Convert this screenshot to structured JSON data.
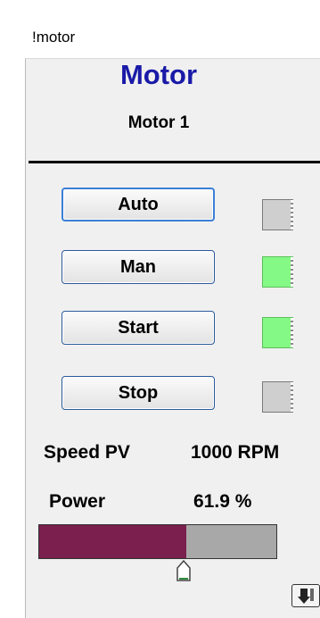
{
  "window": {
    "title": "!motor"
  },
  "header": {
    "title": "Motor",
    "subtitle": "Motor 1"
  },
  "buttons": {
    "auto": "Auto",
    "man": "Man",
    "start": "Start",
    "stop": "Stop"
  },
  "indicators": {
    "auto": "off",
    "man": "on",
    "start": "on",
    "stop": "off"
  },
  "speed": {
    "label": "Speed PV",
    "value": "1000 RPM"
  },
  "power": {
    "label": "Power",
    "value": "61.9 %",
    "bar_fraction": 0.619
  },
  "colors": {
    "title": "#1a1aa8",
    "bar_fill": "#7a1f4e",
    "bar_empty": "#a8a8a8",
    "indicator_on": "#85f985",
    "indicator_off": "#cfcfcf"
  },
  "icons": {
    "setpoint_marker": "triangle-marker-icon",
    "corner": "export-icon"
  }
}
